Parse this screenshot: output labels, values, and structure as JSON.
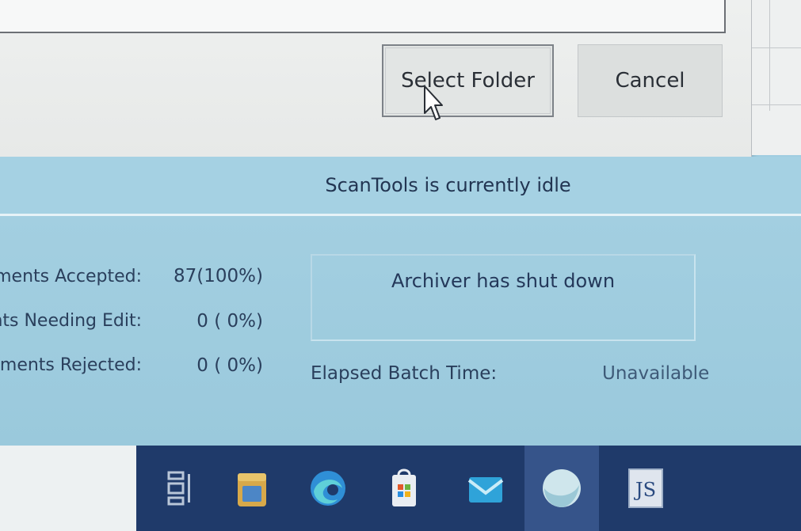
{
  "dialog": {
    "select_folder_label": "Select Folder",
    "cancel_label": "Cancel"
  },
  "status": {
    "message": "ScanTools is currently idle"
  },
  "stats": {
    "rows": [
      {
        "label": "Documents Accepted:",
        "value": "87(100%)"
      },
      {
        "label": "Documents Needing Edit:",
        "value": "0 ( 0%)"
      },
      {
        "label": "Documents Rejected:",
        "value": "0 ( 0%)"
      }
    ],
    "archiver_status": "Archiver has shut down",
    "elapsed_label": "Elapsed Batch Time:",
    "elapsed_value": "Unavailable"
  },
  "taskbar": {
    "items": [
      {
        "icon": "task-view-icon"
      },
      {
        "icon": "file-explorer-icon"
      },
      {
        "icon": "edge-browser-icon"
      },
      {
        "icon": "microsoft-store-icon"
      },
      {
        "icon": "mail-icon"
      },
      {
        "icon": "app-circle-icon",
        "active": true
      },
      {
        "icon": "js-app-icon",
        "text": "JS"
      }
    ]
  },
  "colors": {
    "panel_blue": "#9fcde0",
    "taskbar": "#1f3a6a",
    "text": "#24385a"
  }
}
